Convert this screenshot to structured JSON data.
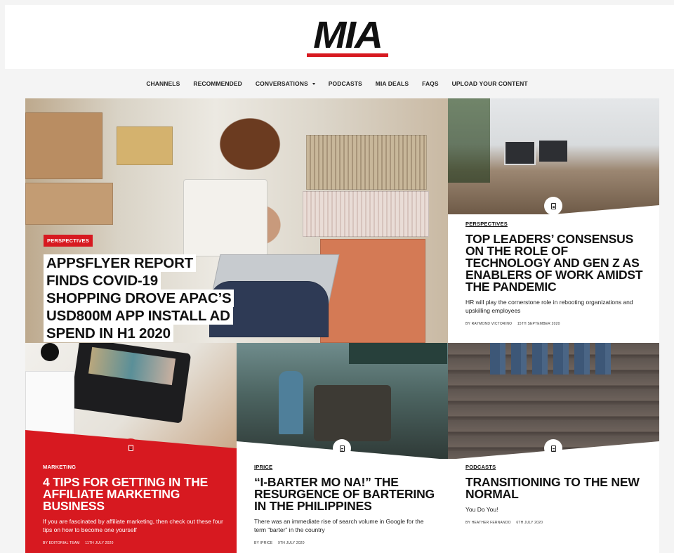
{
  "brand": {
    "logo_text": "MIA",
    "accent": "#d71920"
  },
  "nav": {
    "items": [
      {
        "label": "CHANNELS"
      },
      {
        "label": "RECOMMENDED"
      },
      {
        "label": "CONVERSATIONS",
        "has_dropdown": true
      },
      {
        "label": "PODCASTS"
      },
      {
        "label": "MIA DEALS"
      },
      {
        "label": "FAQS"
      },
      {
        "label": "UPLOAD YOUR CONTENT"
      }
    ]
  },
  "hero": {
    "category": "PERSPECTIVES",
    "title": "APPSFLYER REPORT FINDS COVID-19 SHOPPING DROVE APAC’S USD800M APP INSTALL AD SPEND IN H1 2020"
  },
  "cards": {
    "top_right": {
      "category": "PERSPECTIVES",
      "title": "TOP LEADERS’ CONSENSUS ON THE ROLE OF TECHNOLOGY AND GEN Z AS ENABLERS OF WORK AMIDST THE PANDEMIC",
      "excerpt": "HR will play the cornerstone role in rebooting organizations and upskilling employees",
      "author": "BY RAYMOND VICTORINO",
      "date": "15TH SEPTEMBER 2020"
    },
    "bottom_1": {
      "category": "MARKETING",
      "title": "4 TIPS FOR GETTING IN THE AFFILIATE MARKETING BUSINESS",
      "excerpt": "If you are fascinated by affiliate marketing, then check out these four tips on how to become one yourself",
      "author": "BY EDITORIAL TEAM",
      "date": "11TH JULY 2020"
    },
    "bottom_2": {
      "category": "IPRICE",
      "title": "“I-BARTER MO NA!” THE RESURGENCE OF BARTERING IN THE PHILIPPINES",
      "excerpt": "There was an immediate rise of search volume in Google for the term “barter” in the country",
      "author": "BY IPRICE",
      "date": "9TH JULY 2020"
    },
    "bottom_3": {
      "category": "PODCASTS",
      "title": "TRANSITIONING TO THE NEW NORMAL",
      "excerpt": "You Do You!",
      "author": "BY HEATHER FERNANDO",
      "date": "6TH JULY 2020"
    }
  }
}
